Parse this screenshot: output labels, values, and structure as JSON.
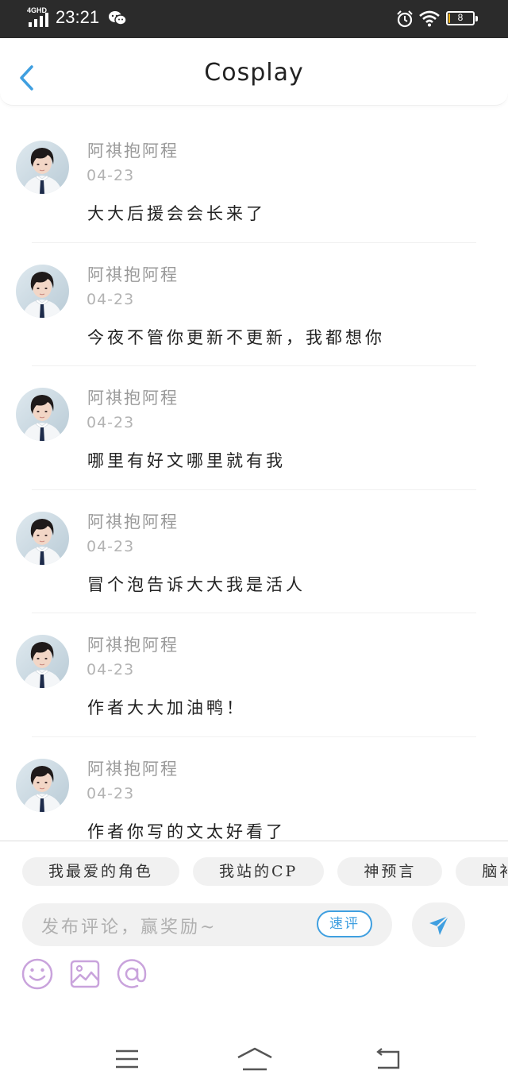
{
  "status_bar": {
    "network": "4GHD",
    "time": "23:21",
    "battery_level": "8",
    "battery_fraction": 0.08
  },
  "header": {
    "title": "Cosplay"
  },
  "comments": [
    {
      "name": "阿祺抱阿程",
      "date": "04-23",
      "text": "大大后援会会长来了"
    },
    {
      "name": "阿祺抱阿程",
      "date": "04-23",
      "text": "今夜不管你更新不更新，我都想你"
    },
    {
      "name": "阿祺抱阿程",
      "date": "04-23",
      "text": "哪里有好文哪里就有我"
    },
    {
      "name": "阿祺抱阿程",
      "date": "04-23",
      "text": "冒个泡告诉大大我是活人"
    },
    {
      "name": "阿祺抱阿程",
      "date": "04-23",
      "text": "作者大大加油鸭！"
    },
    {
      "name": "阿祺抱阿程",
      "date": "04-23",
      "text": "作者你写的文太好看了"
    }
  ],
  "quick_chips": [
    "我最爱的角色",
    "我站的CP",
    "神预言",
    "脑补"
  ],
  "comment_input": {
    "placeholder": "发布评论，赢奖励~",
    "quick_button": "速评"
  },
  "colors": {
    "accent": "#3f9fe0",
    "icon_purple": "#c9a3dc",
    "status_bar_bg": "#2b2b2b"
  },
  "icons": [
    "back-icon",
    "send-icon",
    "emoji-icon",
    "image-icon",
    "mention-icon",
    "menu-icon",
    "home-icon",
    "back-nav-icon"
  ]
}
